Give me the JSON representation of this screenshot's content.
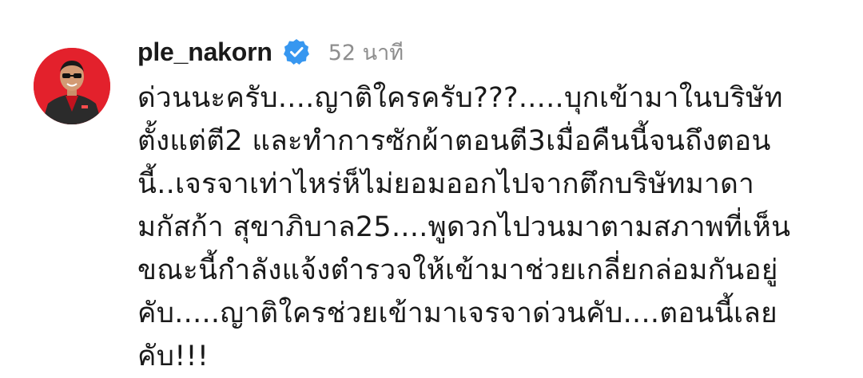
{
  "comment": {
    "username": "ple_nakorn",
    "verified_icon": "verified-badge-icon",
    "verified_color": "#3797f0",
    "time": "52 นาที",
    "lines": [
      "ด่วนนะครับ....ญาติใครครับ???.....บุกเข้ามาในบริษัท",
      "ตั้งแต่ตี2 และทำการซักผ้าตอนตี3เมื่อคืนนี้จนถึงตอน",
      "นี้..เจรจาเท่าไหร่ห็ไม่ยอมออกไปจากตึกบริษัทมาดา",
      "มกัสก้า สุขาภิบาล25....พูดวกไปวนมาตามสภาพที่เห็น",
      "ขณะนี้กำลังแจ้งตำรวจให้เข้ามาช่วยเกลี่ยกล่อมกันอยู่",
      "คับ.....ญาติใครช่วยเข้ามาเจรจาด่วนคับ....ตอนนี้เลย",
      "คับ!!!"
    ]
  },
  "avatar": {
    "icon": "profile-avatar",
    "background": "#e3212c"
  }
}
